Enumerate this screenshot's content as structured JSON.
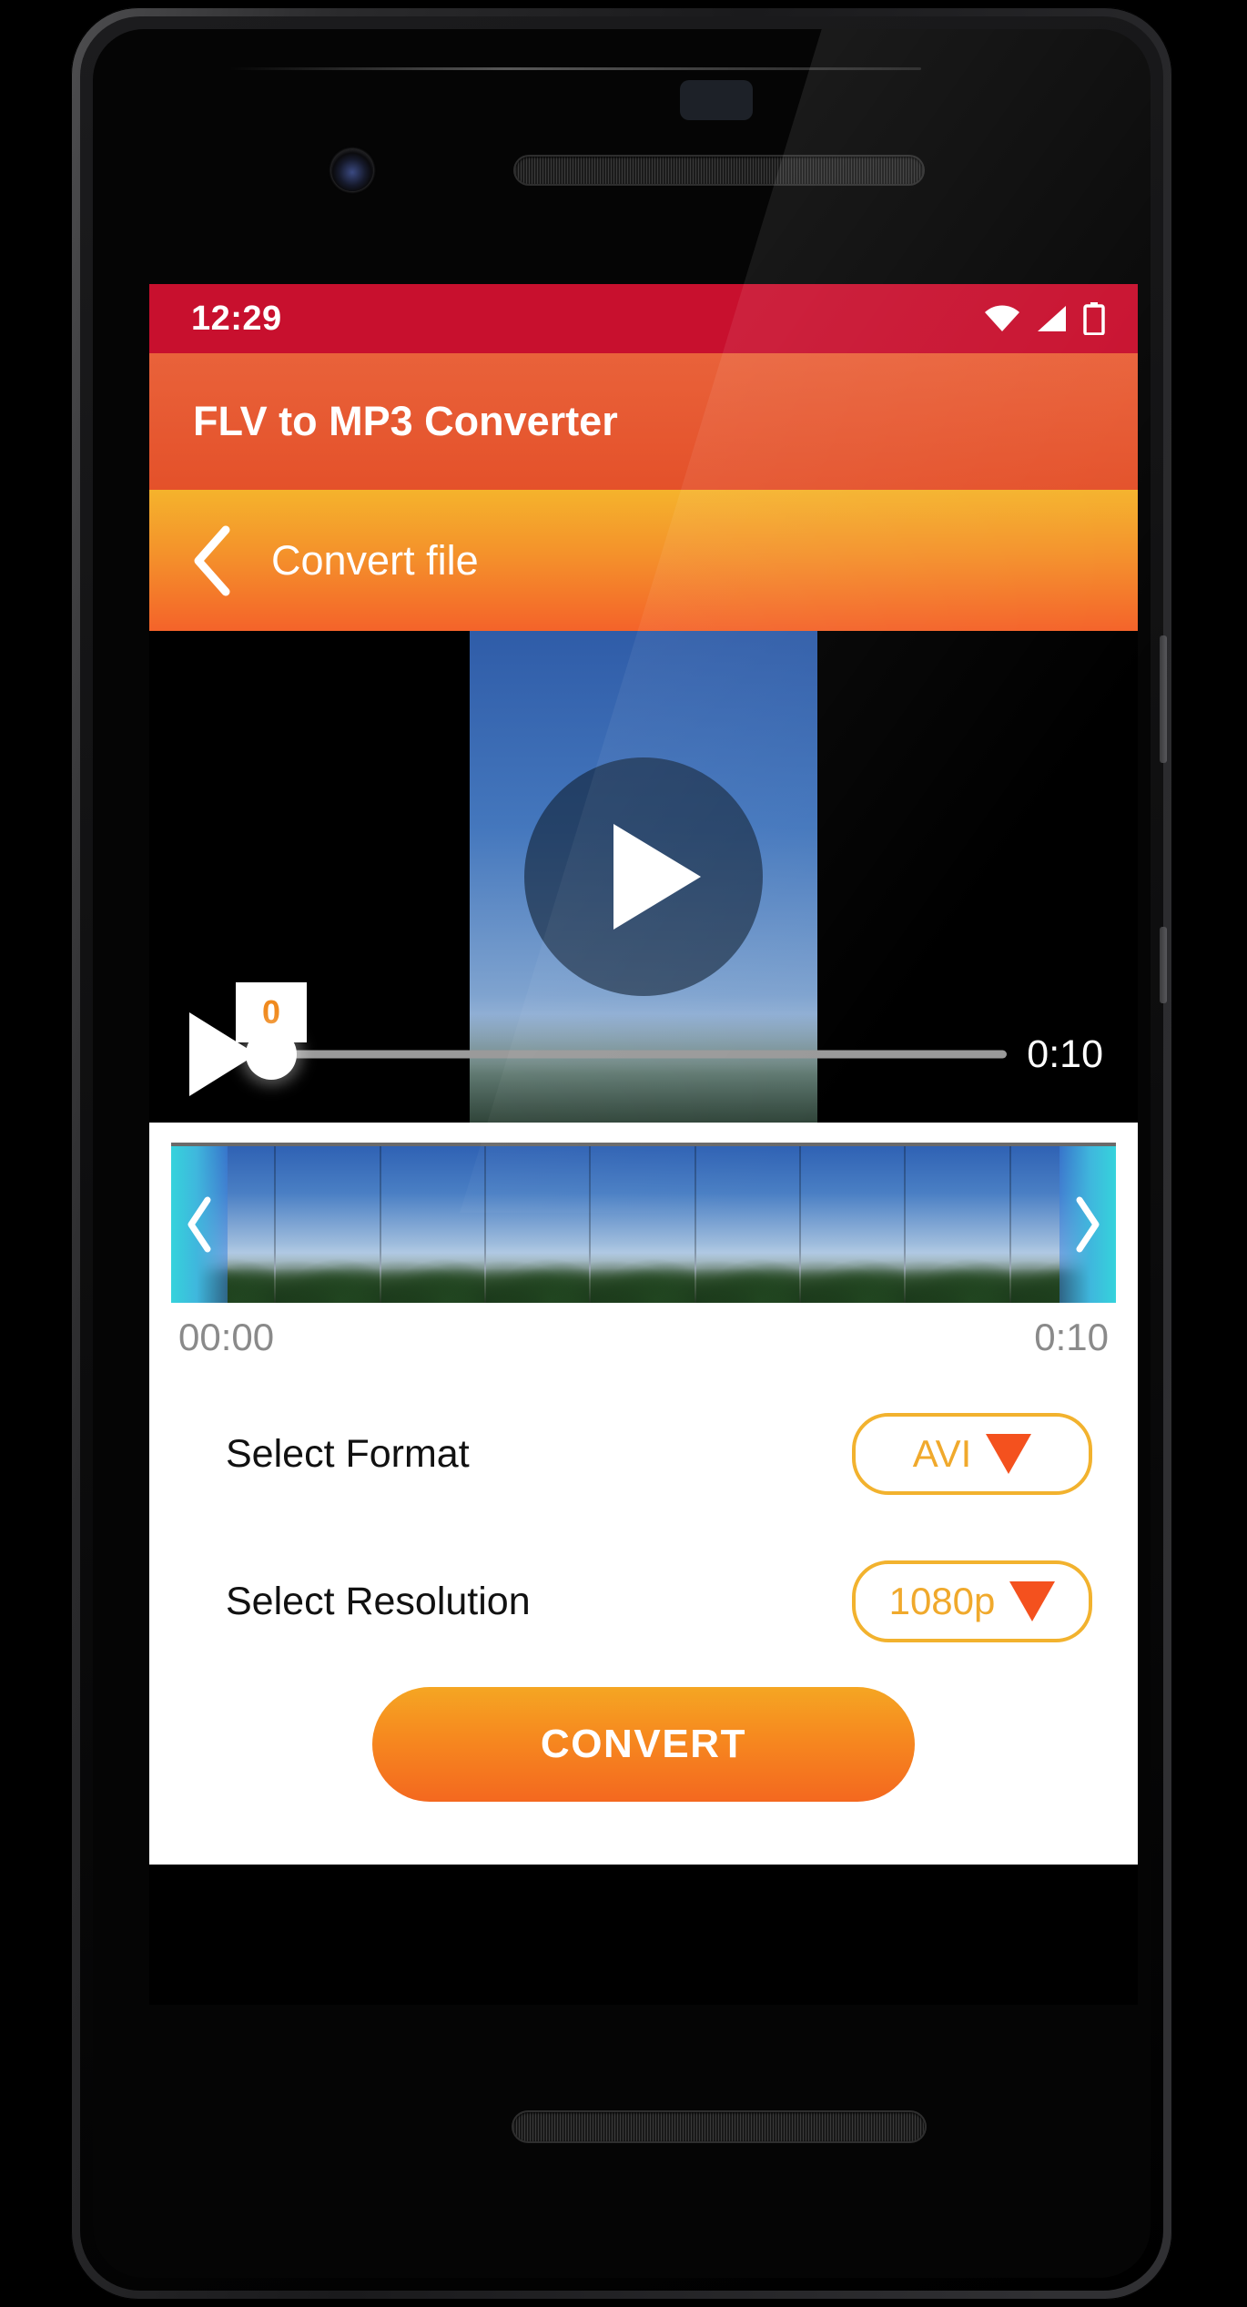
{
  "device": {
    "hardware": {
      "front_camera": "front-camera-lens",
      "earpiece": "earpiece-speaker",
      "proximity_sensor": "proximity-sensor",
      "bottom_speaker": "bottom-speaker-grille",
      "power_button": "power-button",
      "volume_button": "volume-button"
    }
  },
  "status_bar": {
    "time": "12:29",
    "background": "#C8102E",
    "icons": [
      "wifi-icon",
      "signal-icon",
      "battery-icon"
    ]
  },
  "app_bar": {
    "title": "FLV to MP3 Converter",
    "background_from": "#E9623A",
    "background_to": "#E4512A"
  },
  "sub_bar": {
    "back_icon": "chevron-left-icon",
    "title": "Convert file",
    "background_from": "#F5B32C",
    "background_to": "#F4632A"
  },
  "video_player": {
    "play_overlay_icon": "play-icon",
    "seek_play_icon": "play-icon",
    "seek_value_bubble": "0",
    "seek_position_percent": 1,
    "duration": "0:10",
    "bubble_text_color": "#F08A1E"
  },
  "trimmer": {
    "left_handle_icon": "chevron-left-icon",
    "right_handle_icon": "chevron-right-icon",
    "thumbnail_count": 9,
    "start_time": "00:00",
    "end_time": "0:10",
    "handle_color": "#35D3DC"
  },
  "options": [
    {
      "label": "Select Format",
      "value": "AVI",
      "caret_icon": "caret-down-icon",
      "border_color": "#F2B22E",
      "value_color": "#F0A92C",
      "caret_color": "#F4511E"
    },
    {
      "label": "Select Resolution",
      "value": "1080p",
      "caret_icon": "caret-down-icon",
      "border_color": "#F2B22E",
      "value_color": "#F0A92C",
      "caret_color": "#F4511E"
    }
  ],
  "convert_button": {
    "label": "CONVERT",
    "gradient_from": "#F5A623",
    "gradient_to": "#F4681F"
  }
}
